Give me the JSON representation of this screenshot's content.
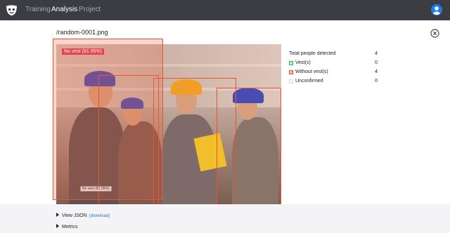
{
  "nav": {
    "items": [
      {
        "label": "Training",
        "active": false
      },
      {
        "label": "Analysis",
        "active": true
      },
      {
        "label": "Project",
        "active": false
      }
    ]
  },
  "main": {
    "filename": "/random-0001.png"
  },
  "detections": [
    {
      "label": "No vest (81.95%)"
    },
    {
      "label": "No vest (81.95%)"
    }
  ],
  "stats": {
    "total_label": "Total people detected",
    "total_value": "4",
    "rows": [
      {
        "label": "Vest(s)",
        "value": "0",
        "color": "#3ab54a"
      },
      {
        "label": "Without vest(s)",
        "value": "4",
        "color": "#e8542c"
      },
      {
        "label": "Unconfirmed",
        "value": "0",
        "color": "#dddddd"
      }
    ]
  },
  "footer": {
    "view_json_label": "View JSON",
    "download_label": "(download)",
    "metrics_label": "Metrics"
  },
  "colors": {
    "topbar": "#3b3d43",
    "accent": "#2a6fd1",
    "bbox": "#e8542c"
  }
}
